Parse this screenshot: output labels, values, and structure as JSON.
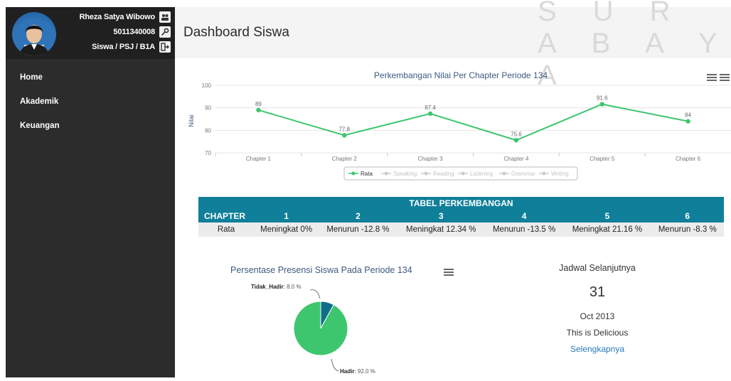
{
  "profile": {
    "name": "Rheza Satya Wibowo",
    "id": "5011340008",
    "class": "Siswa / PSJ / B1A"
  },
  "nav": {
    "items": [
      {
        "label": "Home"
      },
      {
        "label": "Akademik"
      },
      {
        "label": "Keuangan"
      }
    ]
  },
  "header": {
    "title": "Dashboard Siswa",
    "watermark": "S U R A B A Y A"
  },
  "chart_data": [
    {
      "type": "line",
      "title": "Perkembangan Nilai Per Chapter Periode 134",
      "ylabel": "Nilai",
      "categories": [
        "Chapter 1",
        "Chapter 2",
        "Chapter 3",
        "Chapter 4",
        "Chapter 5",
        "Chapter 6"
      ],
      "yticks": [
        70,
        80,
        90,
        100
      ],
      "ylim": [
        70,
        100
      ],
      "series": [
        {
          "name": "Rata",
          "values": [
            89,
            77.8,
            87.4,
            75.6,
            91.6,
            84
          ],
          "color": "#3ec66e",
          "visible": true
        },
        {
          "name": "Speaking",
          "visible": false
        },
        {
          "name": "Reading",
          "visible": false
        },
        {
          "name": "Listening",
          "visible": false
        },
        {
          "name": "Grammar",
          "visible": false
        },
        {
          "name": "Writing",
          "visible": false
        }
      ],
      "legend_position": "bottom"
    },
    {
      "type": "pie",
      "title": "Persentase Presensi Siswa Pada Periode 134",
      "slices": [
        {
          "label": "Tidak_Hadir",
          "value": 8.0,
          "display": "8.0 %",
          "color": "#0f6f8a"
        },
        {
          "label": "Hadir",
          "value": 92.0,
          "display": "92.0 %",
          "color": "#3ec66e"
        }
      ]
    }
  ],
  "table": {
    "title": "TABEL PERKEMBANGAN",
    "header_label": "CHAPTER",
    "columns": [
      "1",
      "2",
      "3",
      "4",
      "5",
      "6"
    ],
    "rows": [
      {
        "label": "Rata",
        "cells": [
          "Meningkat 0%",
          "Menurun -12.8 %",
          "Meningkat 12.34 %",
          "Menurun -13.5 %",
          "Meningkat 21.16 %",
          "Menurun -8.3 %"
        ]
      }
    ]
  },
  "schedule": {
    "heading": "Jadwal Selanjutnya",
    "day": "31",
    "month": "Oct 2013",
    "event": "This is Delicious",
    "link": "Selengkapnya"
  },
  "colors": {
    "sidebar": "#2c2c2c",
    "table_header": "#0f7f9a",
    "accent_green": "#3ec66e",
    "link": "#2a7ab8"
  },
  "icons": [
    "user-group-icon",
    "key-icon",
    "logout-icon",
    "menu-icon"
  ]
}
